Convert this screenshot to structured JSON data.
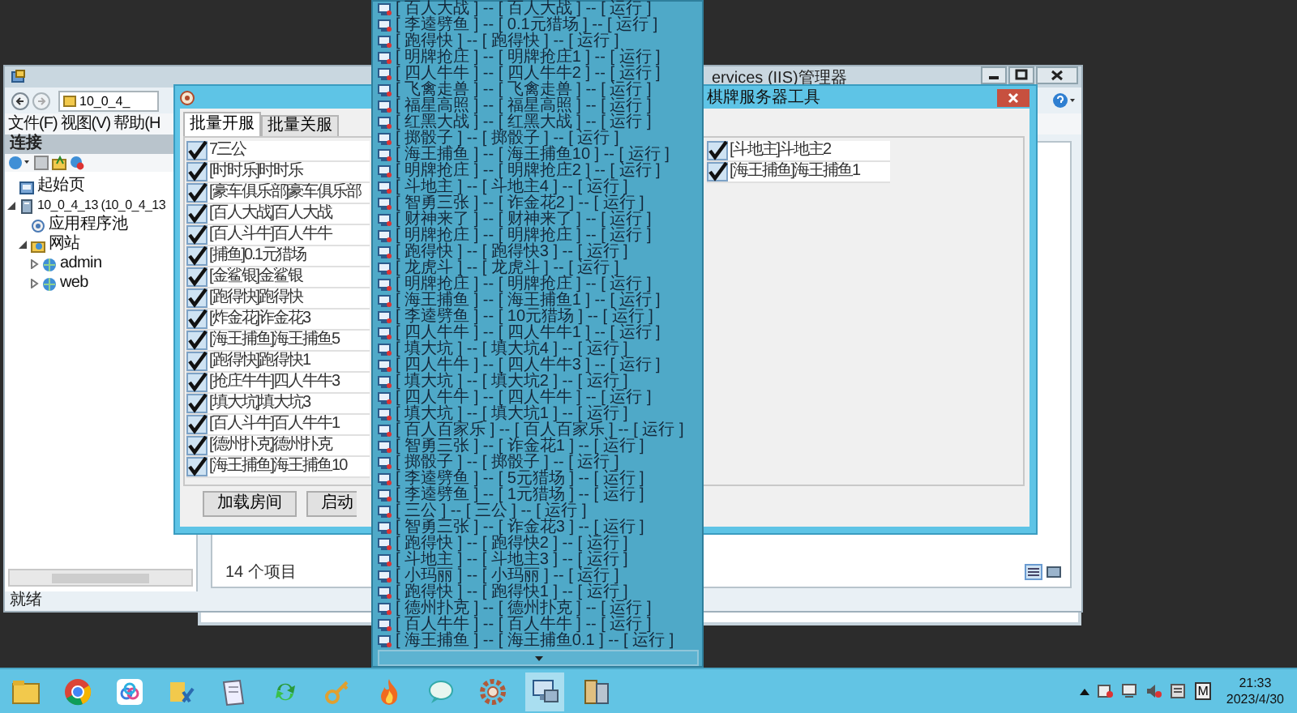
{
  "iis_window": {
    "title": "ervices (IIS)管理器",
    "address": "10_0_4_",
    "menu": [
      "文件(F)",
      "视图(V)",
      "帮助(H"
    ],
    "connections_header": "连接",
    "tree": [
      {
        "label": "起始页",
        "kind": "start_page"
      },
      {
        "label": "10_0_4_13 (10_0_4_13",
        "kind": "server",
        "expanded": true,
        "children": [
          {
            "label": "应用程序池",
            "kind": "app_pools"
          },
          {
            "label": "网站",
            "kind": "sites",
            "expanded": true,
            "children": [
              {
                "label": "admin",
                "kind": "site",
                "expanded": false
              },
              {
                "label": "web",
                "kind": "site",
                "expanded": false
              }
            ]
          }
        ]
      }
    ],
    "status": "就绪",
    "item_count": "14 个项目"
  },
  "tool_dialog": {
    "title": "棋牌服务器工具",
    "tabs": [
      {
        "label": "批量开服",
        "selected": true
      },
      {
        "label": "批量关服",
        "selected": false
      }
    ],
    "room_columns": [
      [
        {
          "label": "7三公",
          "checked": true
        },
        {
          "label": "[时时乐]时时乐",
          "checked": true
        },
        {
          "label": "[豪车俱乐部]豪车俱乐部",
          "checked": true
        },
        {
          "label": "[百人大战]百人大战",
          "checked": true
        },
        {
          "label": "[百人斗牛]百人牛牛",
          "checked": true
        },
        {
          "label": "[捕鱼]0.1元猎场",
          "checked": true
        },
        {
          "label": "[金鲨银]金鲨银",
          "checked": true
        },
        {
          "label": "[跑得快]跑得快",
          "checked": true
        },
        {
          "label": "[炸金花]诈金花3",
          "checked": true
        },
        {
          "label": "[海王捕鱼]海王捕鱼5",
          "checked": true
        },
        {
          "label": "[跑得快]跑得快1",
          "checked": true
        },
        {
          "label": "[抢庄牛牛]四人牛牛3",
          "checked": true
        },
        {
          "label": "[填大坑]填大坑3",
          "checked": true
        },
        {
          "label": "[百人斗牛]百人牛牛1",
          "checked": true
        },
        {
          "label": "[德州扑克]德州扑克",
          "checked": true
        },
        {
          "label": "[海王捕鱼]海王捕鱼10",
          "checked": true
        }
      ],
      [
        {
          "label": "[斗地主]斗地主2",
          "checked": true
        },
        {
          "label": "[海王捕鱼]海王捕鱼1",
          "checked": true
        }
      ]
    ],
    "buttons": [
      "加载房间",
      "启动"
    ]
  },
  "room_popup": [
    {
      "text": "[ 百人大战 ] -- [ 百人大战 ] -- [ 运行 ]"
    },
    {
      "text": "[ 李逵劈鱼 ] -- [ 0.1元猎场 ] -- [ 运行 ]"
    },
    {
      "text": "[ 跑得快 ] -- [ 跑得快 ] -- [ 运行 ]"
    },
    {
      "text": "[ 明牌抢庄 ] -- [ 明牌抢庄1 ] -- [ 运行 ]"
    },
    {
      "text": "[ 四人牛牛 ] -- [ 四人牛牛2 ] -- [ 运行 ]"
    },
    {
      "text": "[ 飞禽走兽 ] -- [ 飞禽走兽 ] -- [ 运行 ]"
    },
    {
      "text": "[ 福星高照 ] -- [ 福星高照 ] -- [ 运行 ]"
    },
    {
      "text": "[ 红黑大战 ] -- [ 红黑大战 ] -- [ 运行 ]"
    },
    {
      "text": "[ 掷骰子 ] -- [ 掷骰子 ] -- [ 运行 ]"
    },
    {
      "text": "[ 海王捕鱼 ] -- [ 海王捕鱼10 ] -- [ 运行 ]"
    },
    {
      "text": "[ 明牌抢庄 ] -- [ 明牌抢庄2 ] -- [ 运行 ]"
    },
    {
      "text": "[ 斗地主 ] -- [ 斗地主4 ] -- [ 运行 ]"
    },
    {
      "text": "[ 智勇三张 ] -- [ 诈金花2 ] -- [ 运行 ]"
    },
    {
      "text": "[ 财神来了 ] -- [ 财神来了 ] -- [ 运行 ]"
    },
    {
      "text": "[ 明牌抢庄 ] -- [ 明牌抢庄 ] -- [ 运行 ]"
    },
    {
      "text": "[ 跑得快 ] -- [ 跑得快3 ] -- [ 运行 ]"
    },
    {
      "text": "[ 龙虎斗 ] -- [ 龙虎斗 ] -- [ 运行 ]"
    },
    {
      "text": "[ 明牌抢庄 ] -- [ 明牌抢庄 ] -- [ 运行 ]"
    },
    {
      "text": "[ 海王捕鱼 ] -- [ 海王捕鱼1 ] -- [ 运行 ]"
    },
    {
      "text": "[ 李逵劈鱼 ] -- [ 10元猎场 ] -- [ 运行 ]"
    },
    {
      "text": "[ 四人牛牛 ] -- [ 四人牛牛1 ] -- [ 运行 ]"
    },
    {
      "text": "[ 填大坑 ] -- [ 填大坑4 ] -- [ 运行 ]"
    },
    {
      "text": "[ 四人牛牛 ] -- [ 四人牛牛3 ] -- [ 运行 ]"
    },
    {
      "text": "[ 填大坑 ] -- [ 填大坑2 ] -- [ 运行 ]"
    },
    {
      "text": "[ 四人牛牛 ] -- [ 四人牛牛 ] -- [ 运行 ]"
    },
    {
      "text": "[ 填大坑 ] -- [ 填大坑1 ] -- [ 运行 ]"
    },
    {
      "text": "[ 百人百家乐 ] -- [ 百人百家乐 ] -- [ 运行 ]"
    },
    {
      "text": "[ 智勇三张 ] -- [ 诈金花1 ] -- [ 运行 ]"
    },
    {
      "text": "[ 掷骰子 ] -- [ 掷骰子 ] -- [ 运行 ]"
    },
    {
      "text": "[ 李逵劈鱼 ] -- [ 5元猎场 ] -- [ 运行 ]"
    },
    {
      "text": "[ 李逵劈鱼 ] -- [ 1元猎场 ] -- [ 运行 ]"
    },
    {
      "text": "[ 三公 ] -- [ 三公 ] -- [ 运行 ]"
    },
    {
      "text": "[ 智勇三张 ] -- [ 诈金花3 ] -- [ 运行 ]"
    },
    {
      "text": "[ 跑得快 ] -- [ 跑得快2 ] -- [ 运行 ]"
    },
    {
      "text": "[ 斗地主 ] -- [ 斗地主3 ] -- [ 运行 ]"
    },
    {
      "text": "[ 小玛丽 ] -- [ 小玛丽 ] -- [ 运行 ]"
    },
    {
      "text": "[ 跑得快 ] -- [ 跑得快1 ] -- [ 运行 ]"
    },
    {
      "text": "[ 德州扑克 ] -- [ 德州扑克 ] -- [ 运行 ]"
    },
    {
      "text": "[ 百人牛牛 ] -- [ 百人牛牛 ] -- [ 运行 ]"
    },
    {
      "text": "[ 海王捕鱼 ] -- [ 海王捕鱼0.1 ] -- [ 运行 ]"
    }
  ],
  "taskbar": {
    "ime": "M",
    "time": "21:33",
    "date": "2023/4/30"
  }
}
